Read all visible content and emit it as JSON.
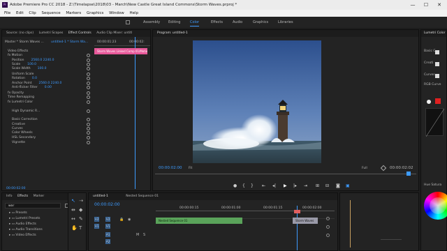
{
  "titlebar": {
    "title": "Adobe Premiere Pro CC 2018 - Z:\\Timelapse\\2018\\03 - March\\New Castle Great Island Commons\\Storm Waves.prproj *",
    "icon": "Pr",
    "min": "—",
    "max": "☐",
    "close": "✕"
  },
  "menu": [
    "File",
    "Edit",
    "Clip",
    "Sequence",
    "Markers",
    "Graphics",
    "Window",
    "Help"
  ],
  "workspaces": [
    "Assembly",
    "Editing",
    "Color",
    "Effects",
    "Audio",
    "Graphics",
    "Libraries"
  ],
  "workspace_active": "Color",
  "source_panel": {
    "tabs": [
      "Source: (no clips)",
      "Lumetri Scopes",
      "Effect Controls",
      "Audio Clip Mixer: untitl"
    ],
    "master": "Master * Storm Waves ...",
    "sequence": "untitled-1 * Storm Wa...",
    "time1": "00:00:01:23",
    "time2": "00:00:02:",
    "clip_label": "Storm Waves Linked Comp 01/Motio",
    "video_effects": "Video Effects",
    "props": [
      {
        "name": "fx  Motion",
        "value": ""
      },
      {
        "name": "Position",
        "value": "2560.0     2240.0"
      },
      {
        "name": "Scale",
        "value": "100.0"
      },
      {
        "name": "Scale Width",
        "value": "100.0"
      },
      {
        "name": "Uniform Scale",
        "value": ""
      },
      {
        "name": "Rotation",
        "value": "0.0"
      },
      {
        "name": "Anchor Point",
        "value": "2560.0     2240.0"
      },
      {
        "name": "Anti-flicker Filter",
        "value": "0.00"
      },
      {
        "name": "fx  Opacity",
        "value": ""
      },
      {
        "name": "Time Remapping",
        "value": ""
      },
      {
        "name": "fx  Lumetri Color",
        "value": ""
      },
      {
        "name": "High Dynamic R...",
        "value": ""
      },
      {
        "name": "Basic Correction",
        "value": ""
      },
      {
        "name": "Creative",
        "value": ""
      },
      {
        "name": "Curves",
        "value": ""
      },
      {
        "name": "Color Wheels",
        "value": ""
      },
      {
        "name": "HSL Secondary",
        "value": ""
      },
      {
        "name": "Vignette",
        "value": ""
      }
    ],
    "timecode": "00:00:02:00"
  },
  "program": {
    "tab": "Program: untitled-1",
    "timecode": "00:00:02:00",
    "fit": "Fit",
    "full": "Full",
    "duration": "00:00:02:02"
  },
  "lumetri": {
    "tab": "Lumetri Color",
    "items": [
      "Basic C",
      "Creati",
      "Curves",
      "RGB Curve",
      "Hue Satura"
    ]
  },
  "project": {
    "tabs": [
      "Info",
      "Effects",
      "Marker"
    ],
    "search": "war",
    "folders": [
      "Presets",
      "Lumetri Presets",
      "Audio Effects",
      "Audio Transitions",
      "Video Effects"
    ]
  },
  "timeline": {
    "tabs": [
      "untitled-1",
      "Nested Sequence 01"
    ],
    "timecode": "00:00:02:00",
    "ruler": [
      "00:00:00:15",
      "00:00:01:00",
      "00:00:01:15",
      "00:00:02:00"
    ],
    "tracks": [
      "V2",
      "V1",
      "A1",
      "A2"
    ],
    "clip1": "Nested Sequence 01",
    "clip2": "Storm Waves"
  },
  "colors": {
    "accent": "#3d9bff",
    "clip_pink": "#e8599a",
    "clip_green": "#5aa35a",
    "clip_gray": "#9a9aa8"
  }
}
